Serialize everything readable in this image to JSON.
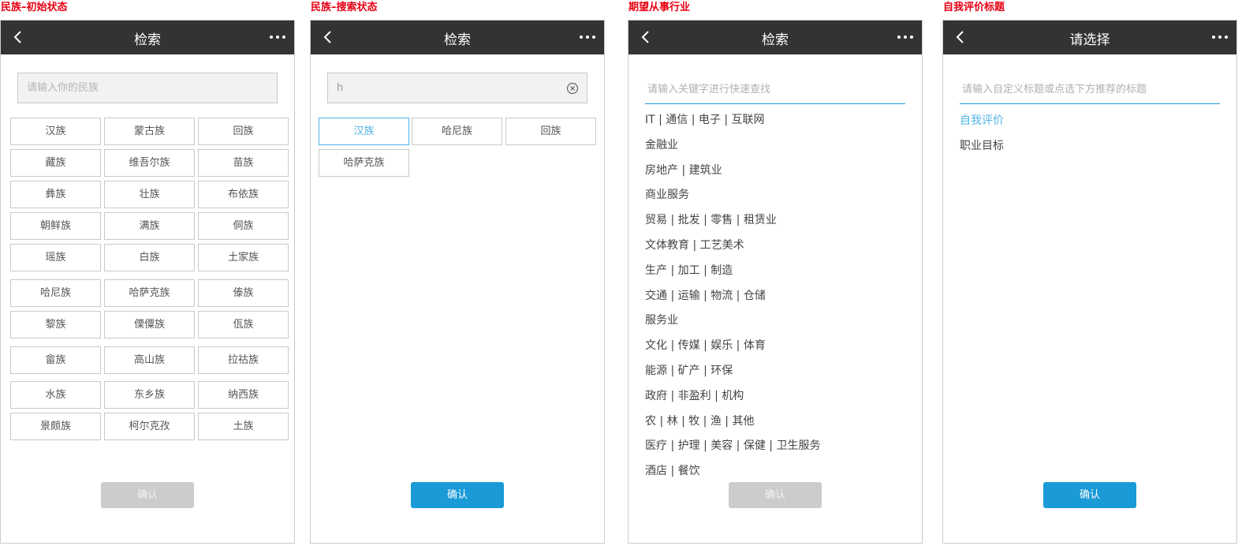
{
  "colors": {
    "caption": "#e60012",
    "navbar": "#333333",
    "accent": "#1a9ad6",
    "selected": "#4fb3e5",
    "disabled": "#cccccc"
  },
  "screens": [
    {
      "caption": "民族–初始状态",
      "title": "检索",
      "placeholder": "请输入你的民族",
      "confirm": "确认",
      "rows": [
        [
          "汉族",
          "蒙古族",
          "回族"
        ],
        [
          "藏族",
          "维吾尔族",
          "苗族"
        ],
        [
          "彝族",
          "壮族",
          "布依族"
        ],
        [
          "朝鲜族",
          "满族",
          "侗族"
        ],
        [
          "瑶族",
          "白族",
          "土家族"
        ],
        [
          "哈尼族",
          "哈萨克族",
          "傣族"
        ],
        [
          "黎族",
          "傈僳族",
          "佤族"
        ],
        [
          "畲族",
          "高山族",
          "拉祜族"
        ],
        [
          "水族",
          "东乡族",
          "纳西族"
        ],
        [
          "景颇族",
          "柯尔克孜",
          "土族"
        ]
      ]
    },
    {
      "caption": "民族–搜索状态",
      "title": "检索",
      "input_value": "h",
      "confirm": "确认",
      "results": [
        "汉族",
        "哈尼族",
        "回族",
        "哈萨克族"
      ]
    },
    {
      "caption": "期望从事行业",
      "title": "检索",
      "placeholder": "请输入关键字进行快速查找",
      "confirm": "确认",
      "industries": [
        "IT | 通信 | 电子 | 互联网",
        "金融业",
        "房地产 | 建筑业",
        "商业服务",
        "贸易 | 批发 | 零售 | 租赁业",
        "文体教育 | 工艺美术",
        "生产 | 加工 | 制造",
        "交通 | 运输 | 物流 | 仓储",
        "服务业",
        "文化 | 传媒 | 娱乐 | 体育",
        "能源 | 矿产 | 环保",
        "政府 | 非盈利 | 机构",
        "农 | 林 | 牧 | 渔 | 其他",
        "医疗 | 护理 | 美容 | 保健 | 卫生服务",
        "酒店 | 餐饮"
      ]
    },
    {
      "caption": "自我评价标题",
      "title": "请选择",
      "placeholder": "请输入自定义标题或点选下方推荐的标题",
      "confirm": "确认",
      "options": [
        "自我评价",
        "职业目标"
      ]
    }
  ]
}
